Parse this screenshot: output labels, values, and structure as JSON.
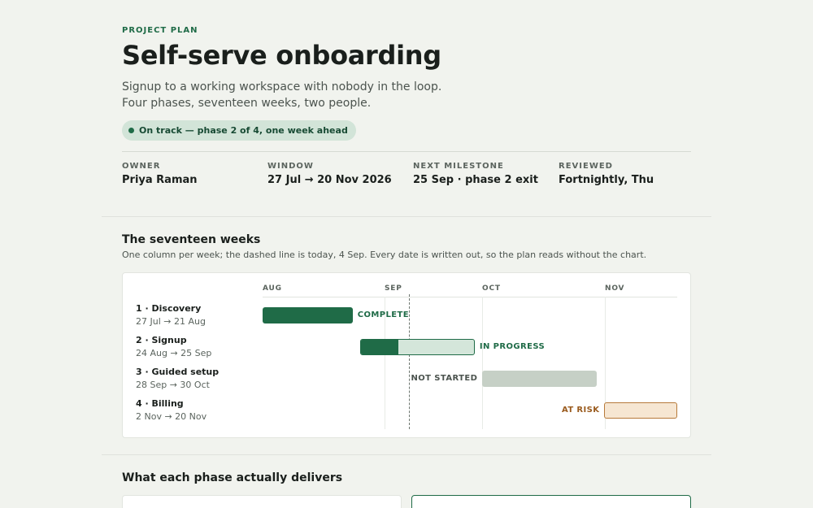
{
  "header": {
    "eyebrow": "PROJECT PLAN",
    "title": "Self-serve onboarding",
    "subtitle_line1": "Signup to a working workspace with nobody in the loop.",
    "subtitle_line2": "Four phases, seventeen weeks, two people.",
    "status_pill": "On track — phase 2 of 4, one week ahead"
  },
  "meta": [
    {
      "key": "OWNER",
      "value": "Priya Raman"
    },
    {
      "key": "WINDOW",
      "value": "27 Jul → 20 Nov 2026"
    },
    {
      "key": "NEXT MILESTONE",
      "value": "25 Sep · phase 2 exit"
    },
    {
      "key": "REVIEWED",
      "value": "Fortnightly, Thu"
    }
  ],
  "timeline": {
    "heading": "The seventeen weeks",
    "caption": "One column per week; the dashed line is today, 4 Sep. Every date is written out, so the plan reads without the chart.",
    "months": [
      "AUG",
      "SEP",
      "OCT",
      "NOV"
    ],
    "today": "2026-09-04",
    "colors": {
      "complete": "#1f6b47",
      "in_progress_done": "#1f6b47",
      "in_progress_rest": "#d4e6da",
      "not_started": "#c6d0c6",
      "at_risk_fill": "#f6e6d2",
      "at_risk_border": "#b77a3a"
    },
    "phases": [
      {
        "label": "1 · Discovery",
        "dates": "27 Jul → 21 Aug",
        "start": "2026-07-27",
        "end": "2026-08-21",
        "status": "COMPLETE",
        "state": "complete",
        "progress": 1.0
      },
      {
        "label": "2 · Signup",
        "dates": "24 Aug → 25 Sep",
        "start": "2026-08-24",
        "end": "2026-09-25",
        "status": "IN PROGRESS",
        "state": "in_progress",
        "progress": 0.33
      },
      {
        "label": "3 · Guided setup",
        "dates": "28 Sep → 30 Oct",
        "start": "2026-09-28",
        "end": "2026-10-30",
        "status": "NOT STARTED",
        "state": "not_started",
        "progress": 0
      },
      {
        "label": "4 · Billing",
        "dates": "2 Nov → 20 Nov",
        "start": "2026-11-02",
        "end": "2026-11-20",
        "status": "AT RISK",
        "state": "at_risk",
        "progress": 0
      }
    ]
  },
  "deliverables": {
    "heading": "What each phase actually delivers"
  }
}
